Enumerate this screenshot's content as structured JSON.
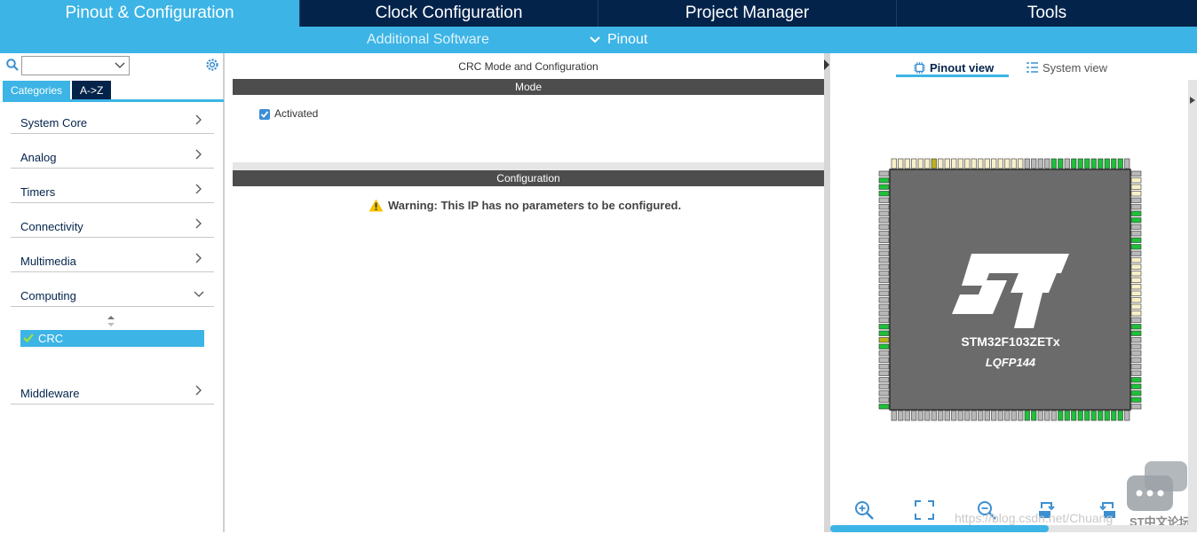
{
  "nav": {
    "tabs": [
      {
        "label": "Pinout & Configuration",
        "active": true
      },
      {
        "label": "Clock Configuration",
        "active": false
      },
      {
        "label": "Project Manager",
        "active": false
      },
      {
        "label": "Tools",
        "active": false
      }
    ],
    "subnav": {
      "additional_software": "Additional Software",
      "pinout": "Pinout"
    }
  },
  "colors": {
    "navy": "#03234b",
    "accent": "#3cb4e6",
    "pin_green": "#1fbf3a",
    "pin_gray": "#b8b8b8",
    "pin_beige": "#f7f0c8",
    "pin_olive": "#b9b21a"
  },
  "left": {
    "search": {
      "value": ""
    },
    "category_tabs": {
      "categories": "Categories",
      "az": "A->Z"
    },
    "categories": [
      "System Core",
      "Analog",
      "Timers",
      "Connectivity",
      "Multimedia",
      "Computing",
      "Middleware"
    ],
    "expanded": "Computing",
    "computing_items": [
      {
        "label": "CRC",
        "enabled": true
      }
    ]
  },
  "middle": {
    "title": "CRC Mode and Configuration",
    "mode_header": "Mode",
    "activated_label": "Activated",
    "activated_checked": true,
    "config_header": "Configuration",
    "warning": "Warning: This IP has no parameters to be configured."
  },
  "right": {
    "tabs": {
      "pinout": "Pinout view",
      "system": "System view"
    },
    "chip": {
      "part": "STM32F103ZETx",
      "package": "LQFP144",
      "logo": "ST"
    },
    "toolbar": [
      "zoom-in",
      "fit",
      "zoom-out",
      "rotate-right",
      "rotate-left",
      "export"
    ],
    "watermark": "https://blog.csdn.net/Chuang",
    "forum_label": "ST中文论坛"
  }
}
